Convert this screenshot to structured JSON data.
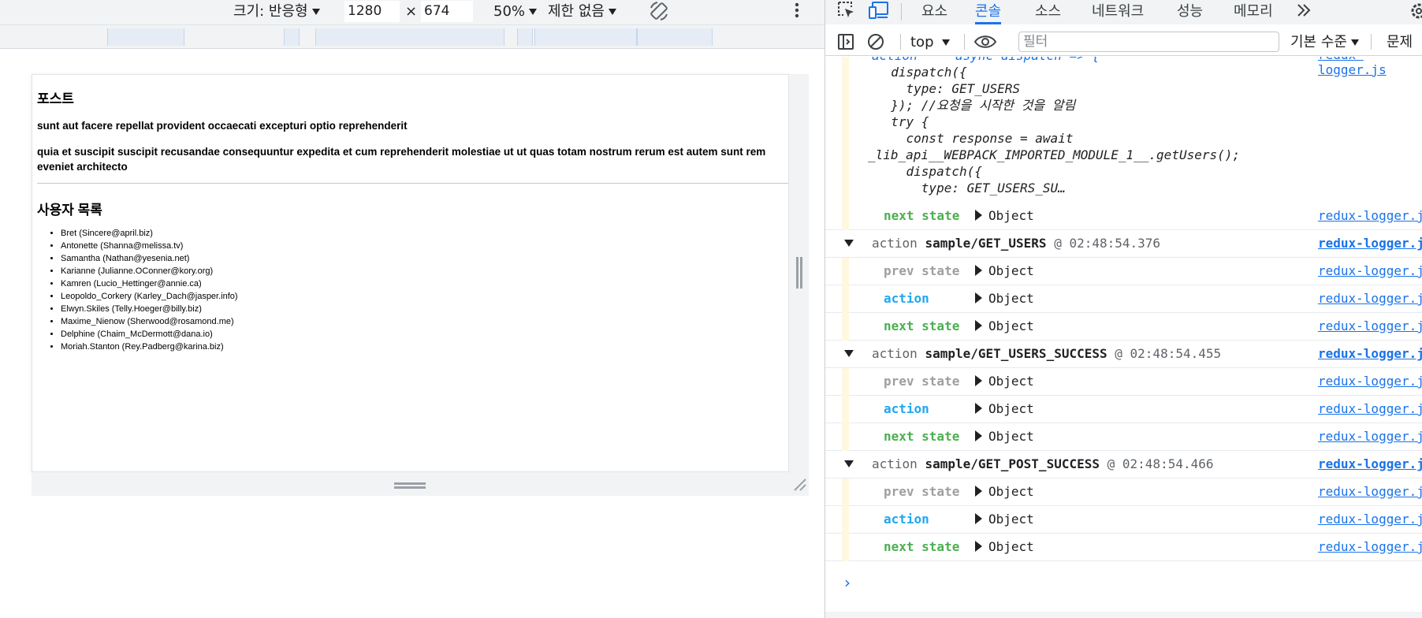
{
  "device_toolbar": {
    "size_label": "크기: 반응형",
    "width": "1280",
    "times": "×",
    "height": "674",
    "zoom": "50%",
    "throttle": "제한 없음"
  },
  "page": {
    "posts_heading": "포스트",
    "post_title": "sunt aut facere repellat provident occaecati excepturi optio reprehenderit",
    "post_body": "quia et suscipit suscipit recusandae consequuntur expedita et cum reprehenderit molestiae ut ut quas totam nostrum rerum est autem sunt rem eveniet architecto",
    "users_heading": "사용자 목록",
    "users": [
      "Bret (Sincere@april.biz)",
      "Antonette (Shanna@melissa.tv)",
      "Samantha (Nathan@yesenia.net)",
      "Karianne (Julianne.OConner@kory.org)",
      "Kamren (Lucio_Hettinger@annie.ca)",
      "Leopoldo_Corkery (Karley_Dach@jasper.info)",
      "Elwyn.Skiles (Telly.Hoeger@billy.biz)",
      "Maxime_Nienow (Sherwood@rosamond.me)",
      "Delphine (Chaim_McDermott@dana.io)",
      "Moriah.Stanton (Rey.Padberg@karina.biz)"
    ]
  },
  "devtools": {
    "tabs": [
      "요소",
      "콘솔",
      "소스",
      "네트워크",
      "성능",
      "메모리"
    ],
    "active_tab": "콘솔",
    "context": "top",
    "filter_placeholder": "필터",
    "levels": "기본 수준",
    "issues": "문제"
  },
  "console": {
    "code_lines": [
      "action     async dispatch => {",
      "  dispatch({",
      "    type: GET_USERS",
      "  }); //요청을 시작한 것을 알림",
      "  try {",
      "    const response = await",
      "_lib_api__WEBPACK_IMPORTED_MODULE_1__.getUsers();",
      "    dispatch({",
      "      type: GET_USERS_SU…"
    ],
    "source": "redux-logger.js",
    "object_label": "Object",
    "labels": {
      "prev": "prev state",
      "action": "action",
      "next": "next state"
    },
    "groups": [
      {
        "prefix": "action ",
        "name": "sample/GET_USERS",
        "at": " @ ",
        "time": "02:48:54.376"
      },
      {
        "prefix": "action ",
        "name": "sample/GET_USERS_SUCCESS",
        "at": " @ ",
        "time": "02:48:54.455"
      },
      {
        "prefix": "action ",
        "name": "sample/GET_POST_SUCCESS",
        "at": " @ ",
        "time": "02:48:54.466"
      }
    ],
    "prompt": "›"
  },
  "colors": {
    "accent": "#1a73e8",
    "prev_state": "#9e9e9e",
    "action": "#1ea7f0",
    "next_state": "#4caf50"
  }
}
